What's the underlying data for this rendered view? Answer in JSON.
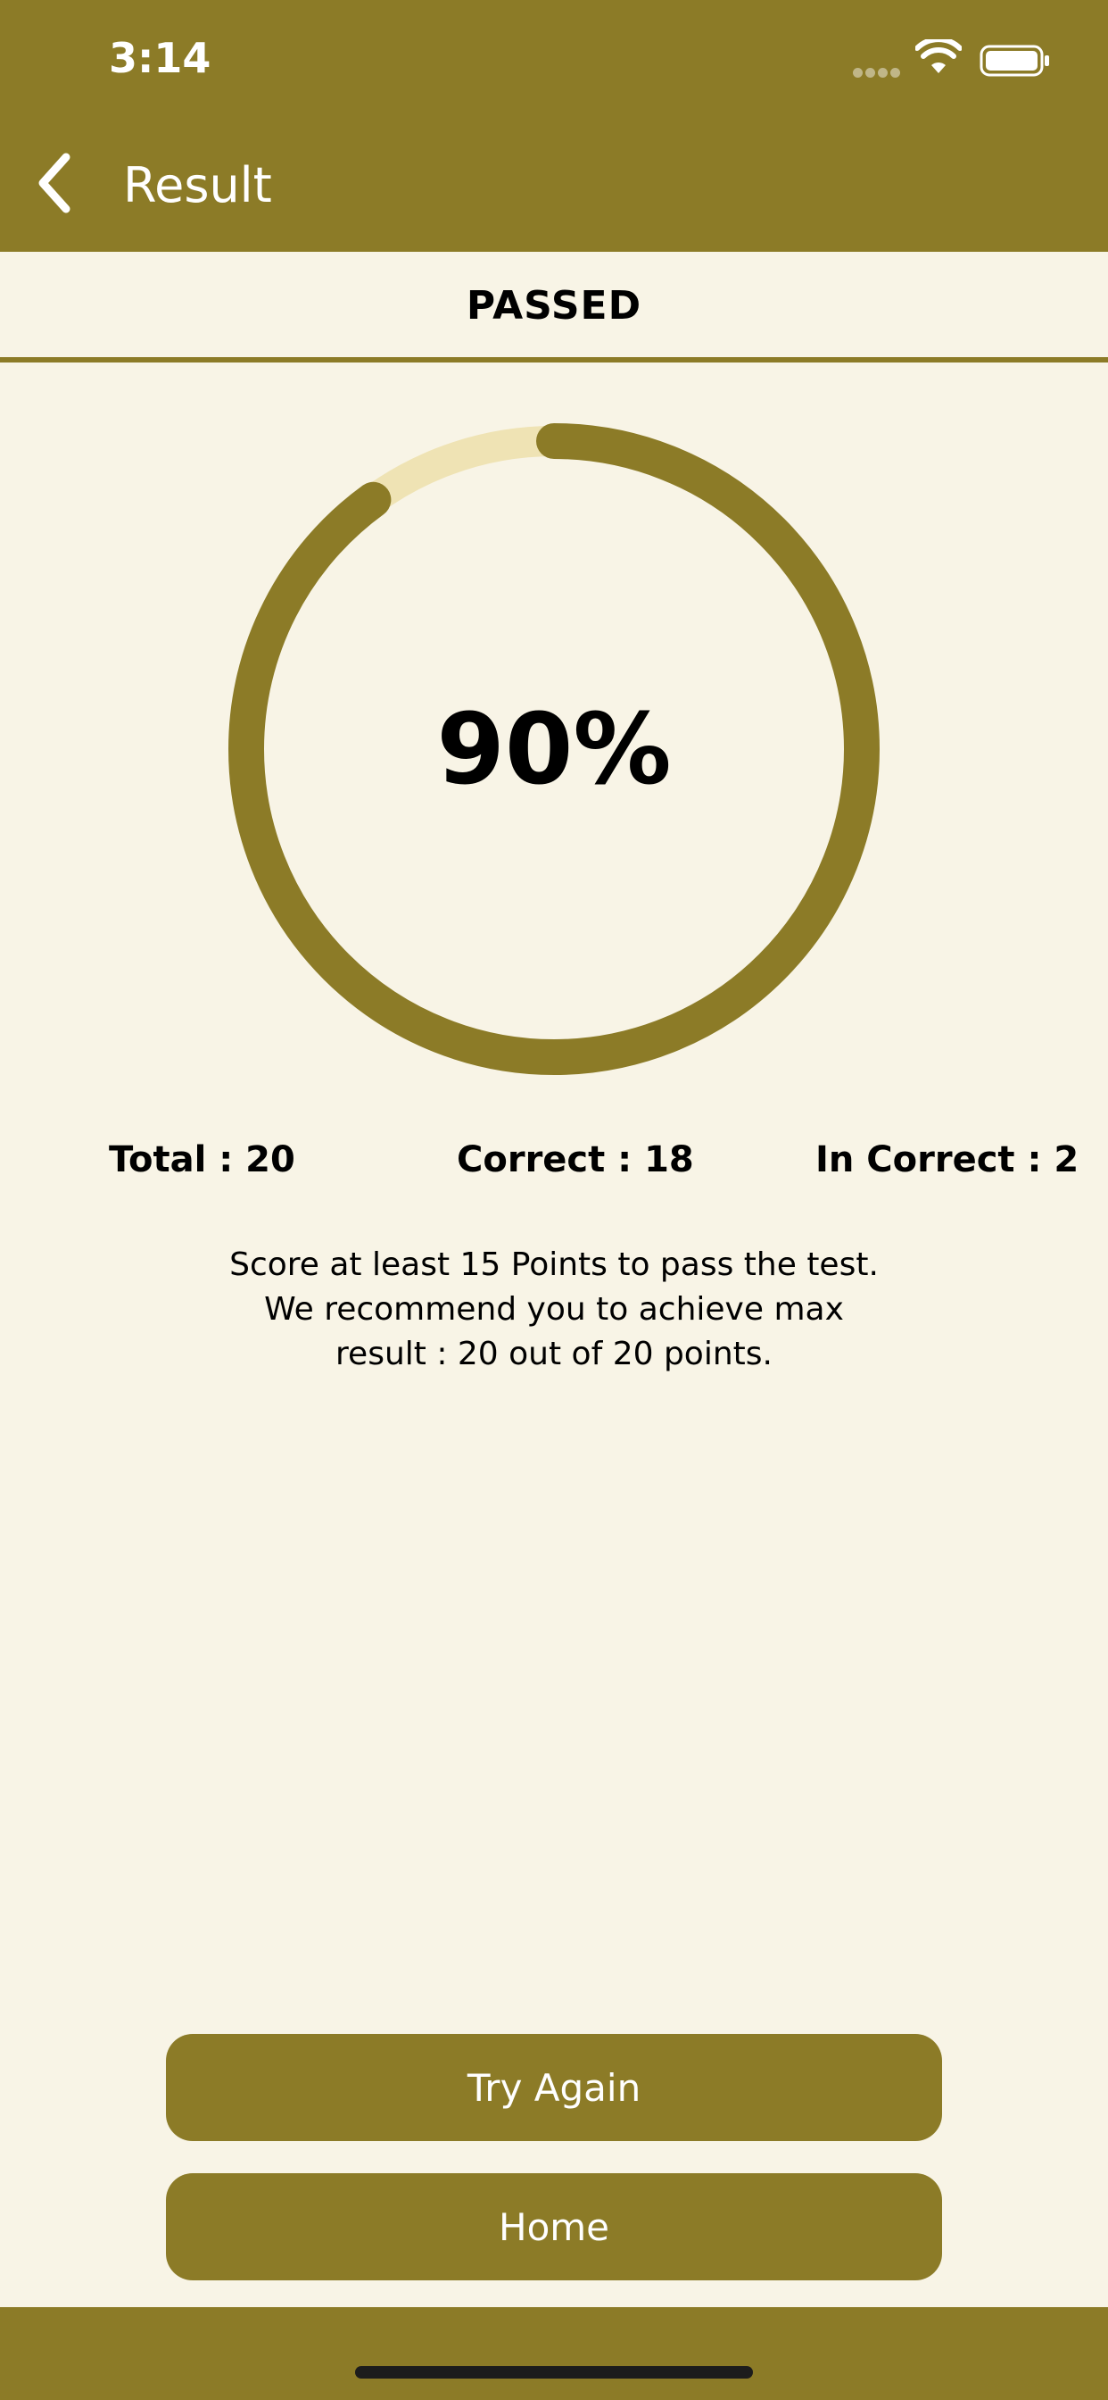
{
  "status": {
    "time": "3:14",
    "icons": [
      "signal-dots-icon",
      "wifi-icon",
      "battery-icon"
    ]
  },
  "nav": {
    "title": "Result",
    "back_icon": "chevron-left-icon"
  },
  "result": {
    "status_text": "PASSED",
    "percent_label": "90%",
    "progress_fraction": 0.9,
    "total_label": "Total : 20",
    "correct_label": "Correct : 18",
    "incorrect_label": "In Correct : 2",
    "info_line1": "Score at least 15 Points to pass the test.",
    "info_line2": "We recommend you to achieve max",
    "info_line3": "result : 20 out of 20 points."
  },
  "actions": {
    "try_again_label": "Try Again",
    "home_label": "Home"
  },
  "colors": {
    "accent": "#8c7b27",
    "background": "#f8f4e6",
    "ring_track": "#efe3b4"
  }
}
